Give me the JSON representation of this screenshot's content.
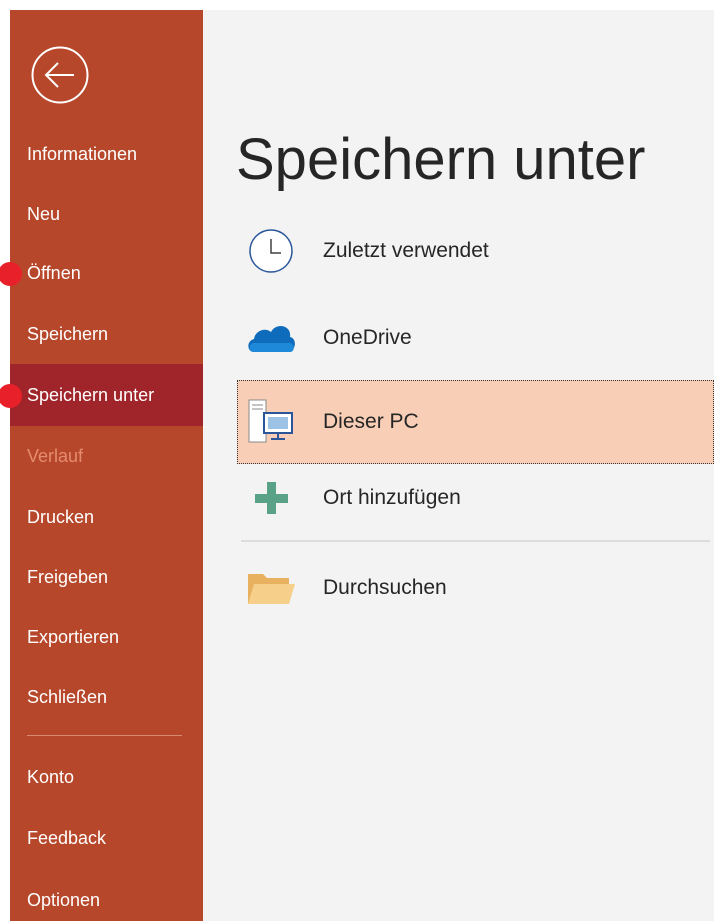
{
  "colors": {
    "sidebar_bg": "#b7472a",
    "sidebar_selected": "#a0252a",
    "sidebar_disabled_text": "#e58b6f",
    "main_bg": "#f3f3f3",
    "location_selected_bg": "#f8cfb6",
    "step_marker": "#e8202a"
  },
  "sidebar": {
    "back_icon": "back-arrow-icon",
    "items": [
      {
        "label": "Informationen"
      },
      {
        "label": "Neu"
      },
      {
        "label": "Öffnen"
      },
      {
        "label": "Speichern"
      },
      {
        "label": "Speichern unter"
      },
      {
        "label": "Verlauf"
      },
      {
        "label": "Drucken"
      },
      {
        "label": "Freigeben"
      },
      {
        "label": "Exportieren"
      },
      {
        "label": "Schließen"
      },
      {
        "label": "Konto"
      },
      {
        "label": "Feedback"
      },
      {
        "label": "Optionen"
      }
    ]
  },
  "main": {
    "title": "Speichern unter",
    "locations": [
      {
        "label": "Zuletzt verwendet",
        "icon": "clock-icon"
      },
      {
        "label": "OneDrive",
        "icon": "cloud-icon"
      },
      {
        "label": "Dieser PC",
        "icon": "computer-icon"
      },
      {
        "label": "Ort hinzufügen",
        "icon": "plus-icon"
      },
      {
        "label": "Durchsuchen",
        "icon": "folder-icon"
      }
    ]
  }
}
